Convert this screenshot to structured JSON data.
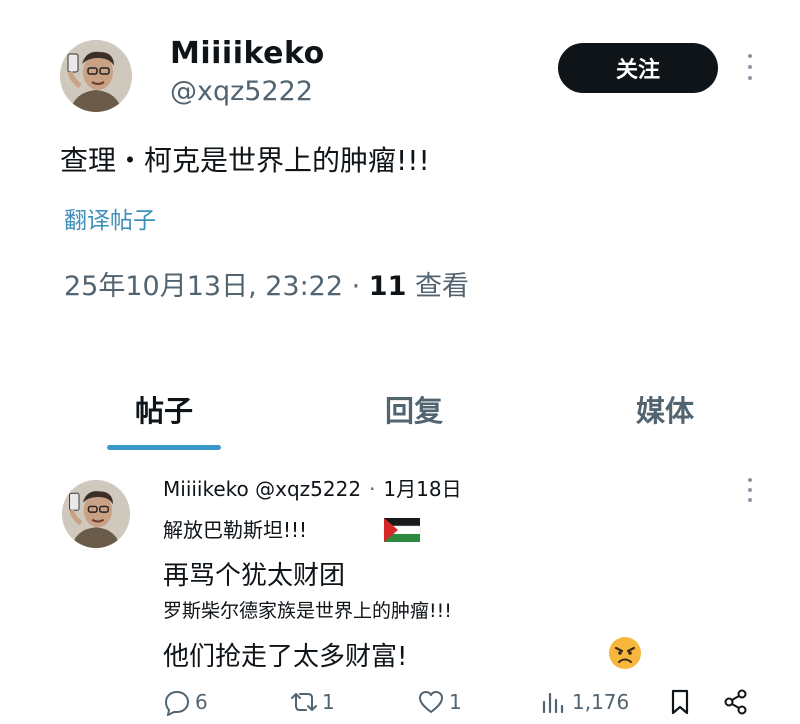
{
  "post": {
    "display_name": "Miiiikeko",
    "handle": "@xqz5222",
    "follow_label": "关注",
    "text": "查理・柯克是世界上的肿瘤!!!",
    "translate_label": "翻译帖子",
    "timestamp": "25年10月13日, 23:22 · ",
    "views_count": "11",
    "views_label": " 查看"
  },
  "tabs": [
    {
      "label": "帖子",
      "active": true
    },
    {
      "label": "回复",
      "active": false
    },
    {
      "label": "媒体",
      "active": false
    }
  ],
  "reply": {
    "display_name": "Miiiikeko",
    "handle": "@xqz5222",
    "separator": "·",
    "date": "1月18日",
    "lines": [
      "解放巴勒斯坦!!!",
      "再骂个犹太财团",
      "罗斯柴尔德家族是世界上的肿瘤!!!",
      "他们抢走了太多财富!"
    ],
    "emoji": [
      "palestine-flag",
      "angry-face"
    ],
    "actions": {
      "replies": "6",
      "retweets": "1",
      "likes": "1",
      "views": "1,176"
    }
  },
  "colors": {
    "text": "#0f1419",
    "secondary": "#536471",
    "link": "#3f8fb8",
    "tab_indicator": "#3a98c8",
    "button_bg": "#0f1419"
  }
}
